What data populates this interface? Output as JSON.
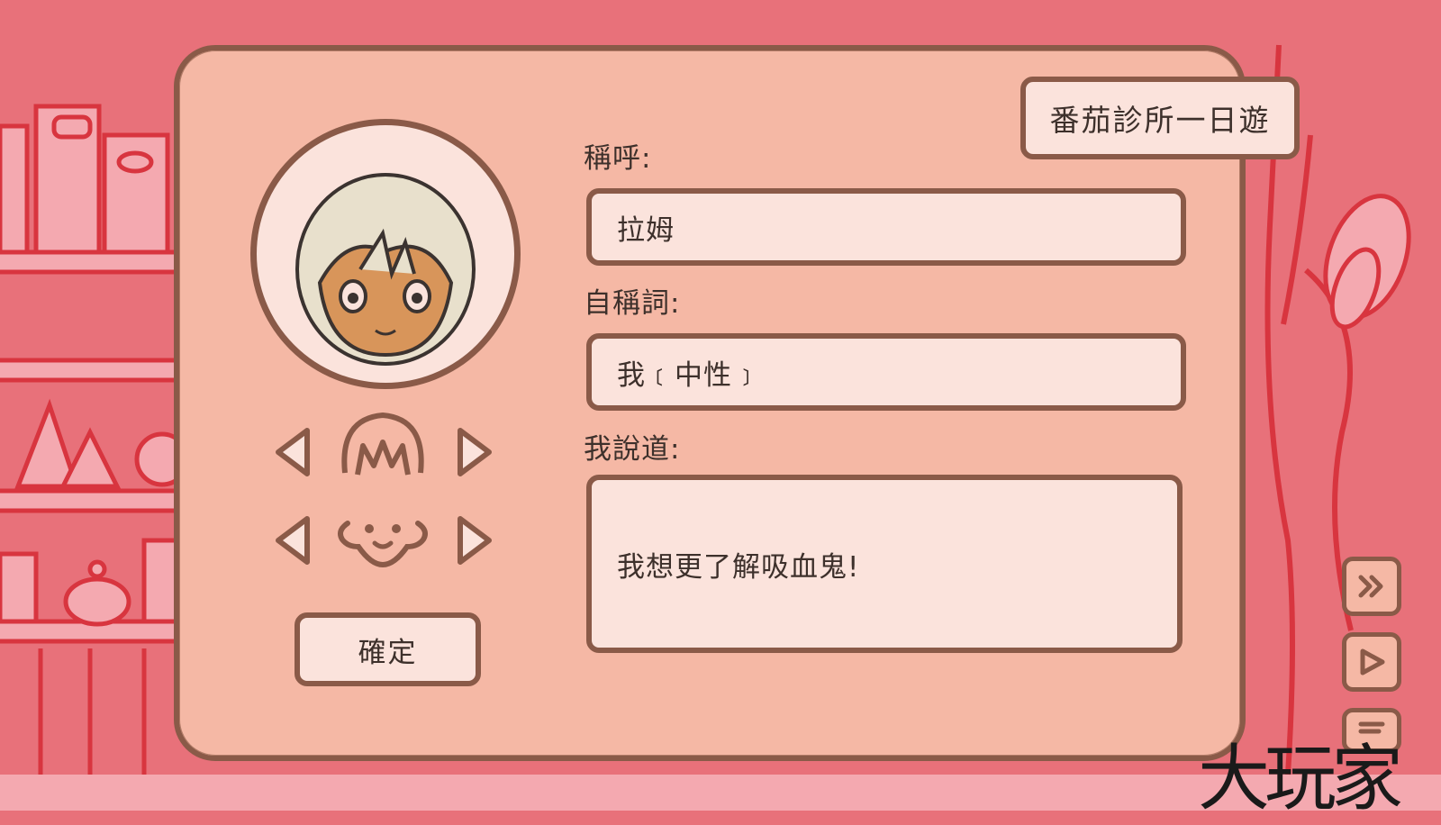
{
  "game_title": "番茄診所一日遊",
  "form": {
    "name_label": "稱呼:",
    "name_value": "拉姆",
    "pronoun_label": "自稱詞:",
    "pronoun_value": "我﹝中性﹞",
    "speech_label": "我說道:",
    "speech_value": "我想更了解吸血鬼!"
  },
  "avatar": {
    "hair_selector": {
      "prev_icon": "triangle-left-icon",
      "next_icon": "triangle-right-icon",
      "part_icon": "hair-icon"
    },
    "face_selector": {
      "prev_icon": "triangle-left-icon",
      "next_icon": "triangle-right-icon",
      "part_icon": "face-icon"
    }
  },
  "confirm_label": "確定",
  "side_controls": [
    "fast-forward-icon",
    "auto-play-icon",
    "log-icon"
  ],
  "watermark_text": "大玩家",
  "colors": {
    "background": "#e8717a",
    "panel": "#f5b8a5",
    "field": "#fbe3dc",
    "outline": "#8a5a48",
    "shelf_line": "#d8353f"
  }
}
